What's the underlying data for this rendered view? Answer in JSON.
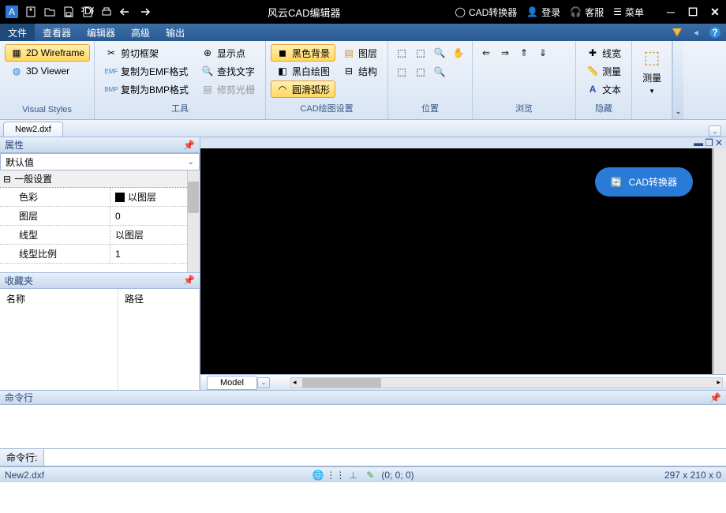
{
  "app": {
    "title": "风云CAD编辑器"
  },
  "titlebar": {
    "converter": "CAD转换器",
    "login": "登录",
    "service": "客服",
    "menu": "菜单"
  },
  "menus": {
    "file": "文件",
    "viewer": "查看器",
    "editor": "编辑器",
    "advanced": "高级",
    "output": "输出"
  },
  "ribbon": {
    "visualStyles": {
      "label": "Visual Styles",
      "wireframe2d": "2D Wireframe",
      "viewer3d": "3D Viewer"
    },
    "tools": {
      "label": "工具",
      "cutFrame": "剪切框架",
      "copyEmf": "复制为EMF格式",
      "copyBmp": "复制为BMP格式",
      "showPoint": "显示点",
      "findText": "查找文字",
      "trimRaster": "修剪光栅"
    },
    "cadSettings": {
      "label": "CAD绘图设置",
      "blackBg": "黑色背景",
      "bwDraw": "黑白绘图",
      "smoothArc": "圆滑弧形",
      "layer": "图层",
      "structure": "结构"
    },
    "position": {
      "label": "位置"
    },
    "browse": {
      "label": "浏览"
    },
    "hide": {
      "label": "隐藏",
      "lineWidth": "线宽",
      "measure": "测量",
      "text": "文本"
    },
    "measure": {
      "label": "测量"
    }
  },
  "fileTab": {
    "name": "New2.dxf"
  },
  "panels": {
    "properties": {
      "title": "属性",
      "default": "默认值",
      "generalSettings": "一般设置",
      "color": "色彩",
      "colorVal": "以图层",
      "layer": "图层",
      "layerVal": "0",
      "lineType": "线型",
      "lineTypeVal": "以图层",
      "lineScale": "线型比例",
      "lineScaleVal": "1"
    },
    "favorites": {
      "title": "收藏夹",
      "name": "名称",
      "path": "路径"
    }
  },
  "canvas": {
    "floatBtn": "CAD转换器",
    "modelTab": "Model"
  },
  "command": {
    "title": "命令行",
    "label": "命令行:"
  },
  "status": {
    "file": "New2.dxf",
    "coords": "(0; 0; 0)",
    "dims": "297 x 210 x 0"
  }
}
